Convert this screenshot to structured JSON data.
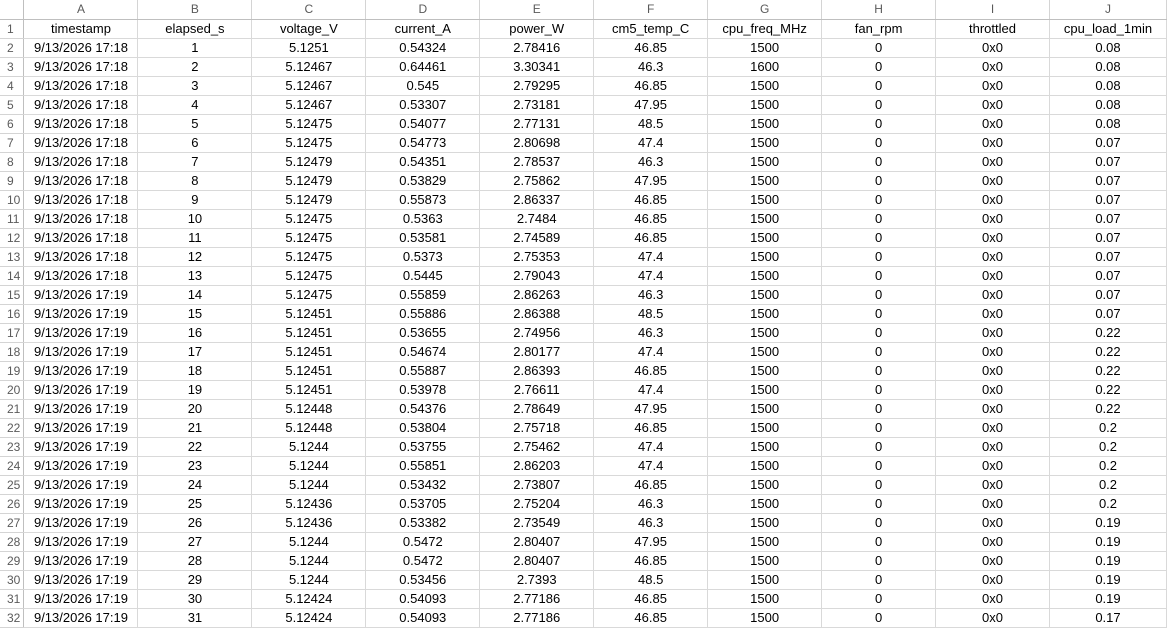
{
  "sheet": {
    "columns": [
      "A",
      "B",
      "C",
      "D",
      "E",
      "F",
      "G",
      "H",
      "I",
      "J"
    ],
    "headers": [
      "timestamp",
      "elapsed_s",
      "voltage_V",
      "current_A",
      "power_W",
      "cm5_temp_C",
      "cpu_freq_MHz",
      "fan_rpm",
      "throttled",
      "cpu_load_1min"
    ],
    "rows": [
      [
        "9/13/2026 17:18",
        "1",
        "5.1251",
        "0.54324",
        "2.78416",
        "46.85",
        "1500",
        "0",
        "0x0",
        "0.08"
      ],
      [
        "9/13/2026 17:18",
        "2",
        "5.12467",
        "0.64461",
        "3.30341",
        "46.3",
        "1600",
        "0",
        "0x0",
        "0.08"
      ],
      [
        "9/13/2026 17:18",
        "3",
        "5.12467",
        "0.545",
        "2.79295",
        "46.85",
        "1500",
        "0",
        "0x0",
        "0.08"
      ],
      [
        "9/13/2026 17:18",
        "4",
        "5.12467",
        "0.53307",
        "2.73181",
        "47.95",
        "1500",
        "0",
        "0x0",
        "0.08"
      ],
      [
        "9/13/2026 17:18",
        "5",
        "5.12475",
        "0.54077",
        "2.77131",
        "48.5",
        "1500",
        "0",
        "0x0",
        "0.08"
      ],
      [
        "9/13/2026 17:18",
        "6",
        "5.12475",
        "0.54773",
        "2.80698",
        "47.4",
        "1500",
        "0",
        "0x0",
        "0.07"
      ],
      [
        "9/13/2026 17:18",
        "7",
        "5.12479",
        "0.54351",
        "2.78537",
        "46.3",
        "1500",
        "0",
        "0x0",
        "0.07"
      ],
      [
        "9/13/2026 17:18",
        "8",
        "5.12479",
        "0.53829",
        "2.75862",
        "47.95",
        "1500",
        "0",
        "0x0",
        "0.07"
      ],
      [
        "9/13/2026 17:18",
        "9",
        "5.12479",
        "0.55873",
        "2.86337",
        "46.85",
        "1500",
        "0",
        "0x0",
        "0.07"
      ],
      [
        "9/13/2026 17:18",
        "10",
        "5.12475",
        "0.5363",
        "2.7484",
        "46.85",
        "1500",
        "0",
        "0x0",
        "0.07"
      ],
      [
        "9/13/2026 17:18",
        "11",
        "5.12475",
        "0.53581",
        "2.74589",
        "46.85",
        "1500",
        "0",
        "0x0",
        "0.07"
      ],
      [
        "9/13/2026 17:18",
        "12",
        "5.12475",
        "0.5373",
        "2.75353",
        "47.4",
        "1500",
        "0",
        "0x0",
        "0.07"
      ],
      [
        "9/13/2026 17:18",
        "13",
        "5.12475",
        "0.5445",
        "2.79043",
        "47.4",
        "1500",
        "0",
        "0x0",
        "0.07"
      ],
      [
        "9/13/2026 17:19",
        "14",
        "5.12475",
        "0.55859",
        "2.86263",
        "46.3",
        "1500",
        "0",
        "0x0",
        "0.07"
      ],
      [
        "9/13/2026 17:19",
        "15",
        "5.12451",
        "0.55886",
        "2.86388",
        "48.5",
        "1500",
        "0",
        "0x0",
        "0.07"
      ],
      [
        "9/13/2026 17:19",
        "16",
        "5.12451",
        "0.53655",
        "2.74956",
        "46.3",
        "1500",
        "0",
        "0x0",
        "0.22"
      ],
      [
        "9/13/2026 17:19",
        "17",
        "5.12451",
        "0.54674",
        "2.80177",
        "47.4",
        "1500",
        "0",
        "0x0",
        "0.22"
      ],
      [
        "9/13/2026 17:19",
        "18",
        "5.12451",
        "0.55887",
        "2.86393",
        "46.85",
        "1500",
        "0",
        "0x0",
        "0.22"
      ],
      [
        "9/13/2026 17:19",
        "19",
        "5.12451",
        "0.53978",
        "2.76611",
        "47.4",
        "1500",
        "0",
        "0x0",
        "0.22"
      ],
      [
        "9/13/2026 17:19",
        "20",
        "5.12448",
        "0.54376",
        "2.78649",
        "47.95",
        "1500",
        "0",
        "0x0",
        "0.22"
      ],
      [
        "9/13/2026 17:19",
        "21",
        "5.12448",
        "0.53804",
        "2.75718",
        "46.85",
        "1500",
        "0",
        "0x0",
        "0.2"
      ],
      [
        "9/13/2026 17:19",
        "22",
        "5.1244",
        "0.53755",
        "2.75462",
        "47.4",
        "1500",
        "0",
        "0x0",
        "0.2"
      ],
      [
        "9/13/2026 17:19",
        "23",
        "5.1244",
        "0.55851",
        "2.86203",
        "47.4",
        "1500",
        "0",
        "0x0",
        "0.2"
      ],
      [
        "9/13/2026 17:19",
        "24",
        "5.1244",
        "0.53432",
        "2.73807",
        "46.85",
        "1500",
        "0",
        "0x0",
        "0.2"
      ],
      [
        "9/13/2026 17:19",
        "25",
        "5.12436",
        "0.53705",
        "2.75204",
        "46.3",
        "1500",
        "0",
        "0x0",
        "0.2"
      ],
      [
        "9/13/2026 17:19",
        "26",
        "5.12436",
        "0.53382",
        "2.73549",
        "46.3",
        "1500",
        "0",
        "0x0",
        "0.19"
      ],
      [
        "9/13/2026 17:19",
        "27",
        "5.1244",
        "0.5472",
        "2.80407",
        "47.95",
        "1500",
        "0",
        "0x0",
        "0.19"
      ],
      [
        "9/13/2026 17:19",
        "28",
        "5.1244",
        "0.5472",
        "2.80407",
        "46.85",
        "1500",
        "0",
        "0x0",
        "0.19"
      ],
      [
        "9/13/2026 17:19",
        "29",
        "5.1244",
        "0.53456",
        "2.7393",
        "48.5",
        "1500",
        "0",
        "0x0",
        "0.19"
      ],
      [
        "9/13/2026 17:19",
        "30",
        "5.12424",
        "0.54093",
        "2.77186",
        "46.85",
        "1500",
        "0",
        "0x0",
        "0.19"
      ],
      [
        "9/13/2026 17:19",
        "31",
        "5.12424",
        "0.54093",
        "2.77186",
        "46.85",
        "1500",
        "0",
        "0x0",
        "0.17"
      ]
    ]
  }
}
